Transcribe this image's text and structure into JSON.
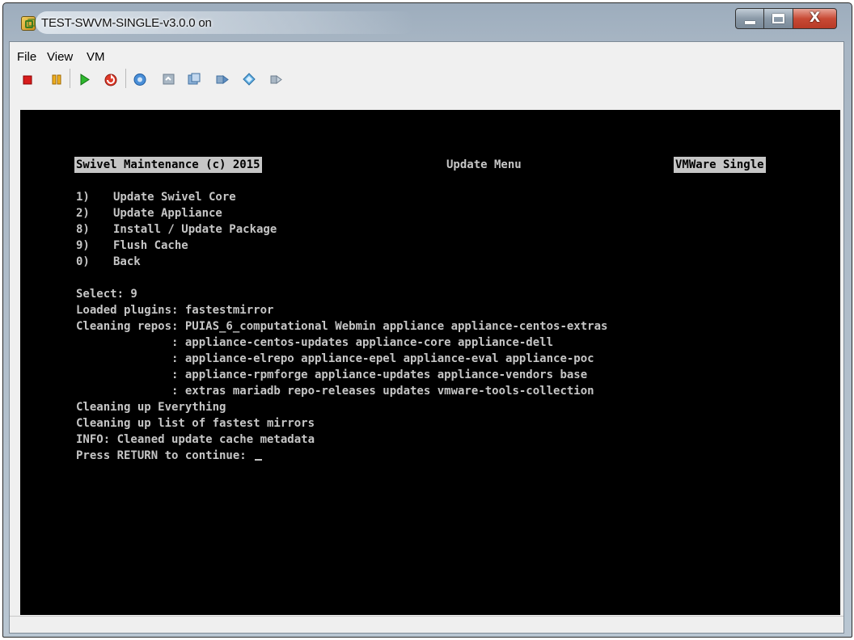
{
  "window": {
    "title": "TEST-SWVM-SINGLE-v3.0.0 on",
    "controls": {
      "minimize_icon": "minimize-icon",
      "maximize_icon": "maximize-icon",
      "close_glyph": "X"
    }
  },
  "menubar": {
    "file": "File",
    "view": "View",
    "vm": "VM"
  },
  "toolbar": {
    "icons": [
      "stop-icon",
      "pause-icon",
      "play-icon",
      "reset-icon",
      "snapshot-icon",
      "revert-snapshot-icon",
      "manage-snapshots-icon",
      "send-ctrl-alt-del-icon",
      "install-tools-icon",
      "console-fit-icon"
    ]
  },
  "console": {
    "header": {
      "left": "Swivel Maintenance (c) 2015",
      "center": "Update Menu",
      "right": "VMWare Single"
    },
    "menu": [
      {
        "key": "1)",
        "label": "Update Swivel Core"
      },
      {
        "key": "2)",
        "label": "Update Appliance"
      },
      {
        "key": "8)",
        "label": "Install / Update Package"
      },
      {
        "key": "9)",
        "label": "Flush Cache"
      },
      {
        "key": "0)",
        "label": "Back"
      }
    ],
    "output": [
      "Select: 9",
      "Loaded plugins: fastestmirror",
      "Cleaning repos: PUIAS_6_computational Webmin appliance appliance-centos-extras",
      "              : appliance-centos-updates appliance-core appliance-dell",
      "              : appliance-elrepo appliance-epel appliance-eval appliance-poc",
      "              : appliance-rpmforge appliance-updates appliance-vendors base",
      "              : extras mariadb repo-releases updates vmware-tools-collection",
      "Cleaning up Everything",
      "Cleaning up list of fastest mirrors",
      "INFO: Cleaned update cache metadata"
    ],
    "prompt": "Press RETURN to continue: "
  }
}
